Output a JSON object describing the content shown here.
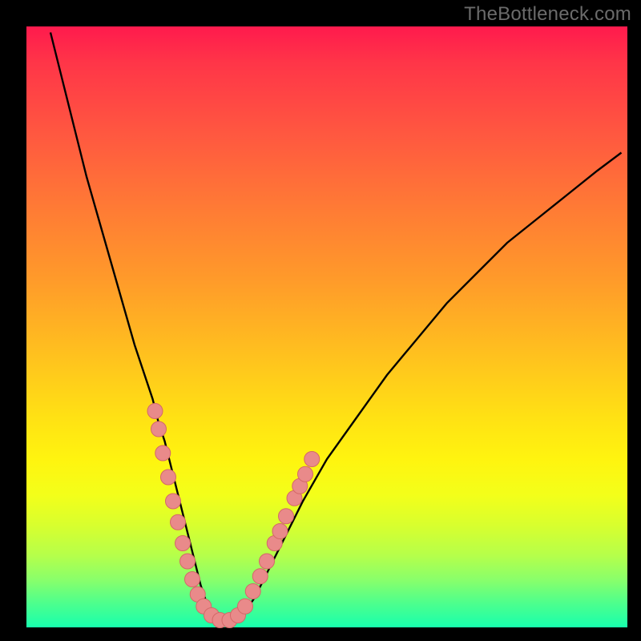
{
  "watermark": {
    "text": "TheBottleneck.com"
  },
  "colors": {
    "curve_stroke": "#000000",
    "dot_fill": "#e98a8a",
    "dot_stroke": "#d46868"
  },
  "chart_data": {
    "type": "line",
    "title": "",
    "xlabel": "",
    "ylabel": "",
    "xlim": [
      0,
      100
    ],
    "ylim": [
      0,
      100
    ],
    "grid": false,
    "legend": false,
    "series": [
      {
        "name": "bottleneck-curve",
        "x": [
          4,
          6,
          8,
          10,
          12,
          14,
          16,
          18,
          20,
          21,
          22,
          23,
          24,
          25,
          26,
          27,
          28,
          29,
          30,
          31,
          32,
          33,
          34,
          35,
          36,
          38,
          40,
          43,
          46,
          50,
          55,
          60,
          65,
          70,
          75,
          80,
          85,
          90,
          95,
          99
        ],
        "y": [
          99,
          91,
          83,
          75,
          68,
          61,
          54,
          47,
          41,
          38,
          34,
          31,
          27,
          23,
          19,
          15,
          11,
          7,
          4,
          2,
          1,
          0.5,
          0.5,
          1,
          2,
          5,
          9,
          15,
          21,
          28,
          35,
          42,
          48,
          54,
          59,
          64,
          68,
          72,
          76,
          79
        ]
      }
    ],
    "dots": {
      "name": "highlight-points",
      "points": [
        {
          "x": 21.4,
          "y": 36
        },
        {
          "x": 22.0,
          "y": 33
        },
        {
          "x": 22.7,
          "y": 29
        },
        {
          "x": 23.6,
          "y": 25
        },
        {
          "x": 24.4,
          "y": 21
        },
        {
          "x": 25.2,
          "y": 17.5
        },
        {
          "x": 26.0,
          "y": 14
        },
        {
          "x": 26.8,
          "y": 11
        },
        {
          "x": 27.6,
          "y": 8
        },
        {
          "x": 28.5,
          "y": 5.5
        },
        {
          "x": 29.5,
          "y": 3.5
        },
        {
          "x": 30.8,
          "y": 2
        },
        {
          "x": 32.2,
          "y": 1.2
        },
        {
          "x": 33.8,
          "y": 1.2
        },
        {
          "x": 35.2,
          "y": 2
        },
        {
          "x": 36.4,
          "y": 3.5
        },
        {
          "x": 37.7,
          "y": 6
        },
        {
          "x": 38.9,
          "y": 8.5
        },
        {
          "x": 40.0,
          "y": 11
        },
        {
          "x": 41.3,
          "y": 14
        },
        {
          "x": 42.2,
          "y": 16
        },
        {
          "x": 43.2,
          "y": 18.5
        },
        {
          "x": 44.6,
          "y": 21.5
        },
        {
          "x": 45.5,
          "y": 23.5
        },
        {
          "x": 46.4,
          "y": 25.5
        },
        {
          "x": 47.5,
          "y": 28
        }
      ]
    }
  }
}
